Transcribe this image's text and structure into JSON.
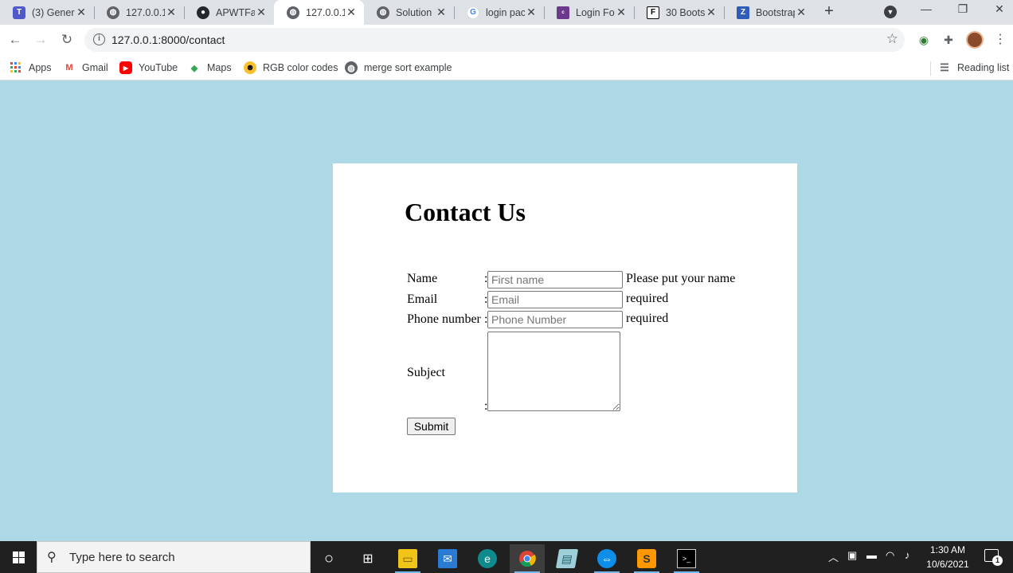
{
  "browser": {
    "tabs": [
      {
        "title": "(3) Gener",
        "icon": "teams-icon"
      },
      {
        "title": "127.0.0.1",
        "icon": "globe-icon"
      },
      {
        "title": "APWTFal",
        "icon": "github-icon"
      },
      {
        "title": "127.0.0.1",
        "icon": "globe-icon",
        "active": true
      },
      {
        "title": "Solution",
        "icon": "globe-icon"
      },
      {
        "title": "login pac",
        "icon": "google-icon"
      },
      {
        "title": "Login For",
        "icon": "colorlib-icon"
      },
      {
        "title": "30 Boots",
        "icon": "f-icon"
      },
      {
        "title": "Bootstrap",
        "icon": "z-icon"
      }
    ],
    "url": "127.0.0.1:8000/contact",
    "bookmarks": [
      {
        "label": "Apps",
        "icon": "apps-grid-icon"
      },
      {
        "label": "Gmail",
        "icon": "gmail-icon"
      },
      {
        "label": "YouTube",
        "icon": "youtube-icon"
      },
      {
        "label": "Maps",
        "icon": "maps-icon"
      },
      {
        "label": "RGB color codes",
        "icon": "rgb-icon"
      },
      {
        "label": "merge sort example",
        "icon": "globe-icon"
      }
    ],
    "reading_list": "Reading list"
  },
  "page": {
    "title": "Contact Us",
    "fields": {
      "name": {
        "label": "Name",
        "colon": ":",
        "placeholder": "First name",
        "hint": "Please put your name"
      },
      "email": {
        "label": "Email",
        "colon": ":",
        "placeholder": "Email",
        "hint": "required"
      },
      "phone": {
        "label": "Phone number",
        "colon": ":",
        "placeholder": "Phone Number",
        "hint": "required"
      },
      "subject": {
        "label": "Subject",
        "colon": ":"
      }
    },
    "submit": "Submit",
    "background": "#add8e6"
  },
  "taskbar": {
    "search_placeholder": "Type here to search",
    "time": "1:30 AM",
    "date": "10/6/2021",
    "notifications": "1"
  }
}
